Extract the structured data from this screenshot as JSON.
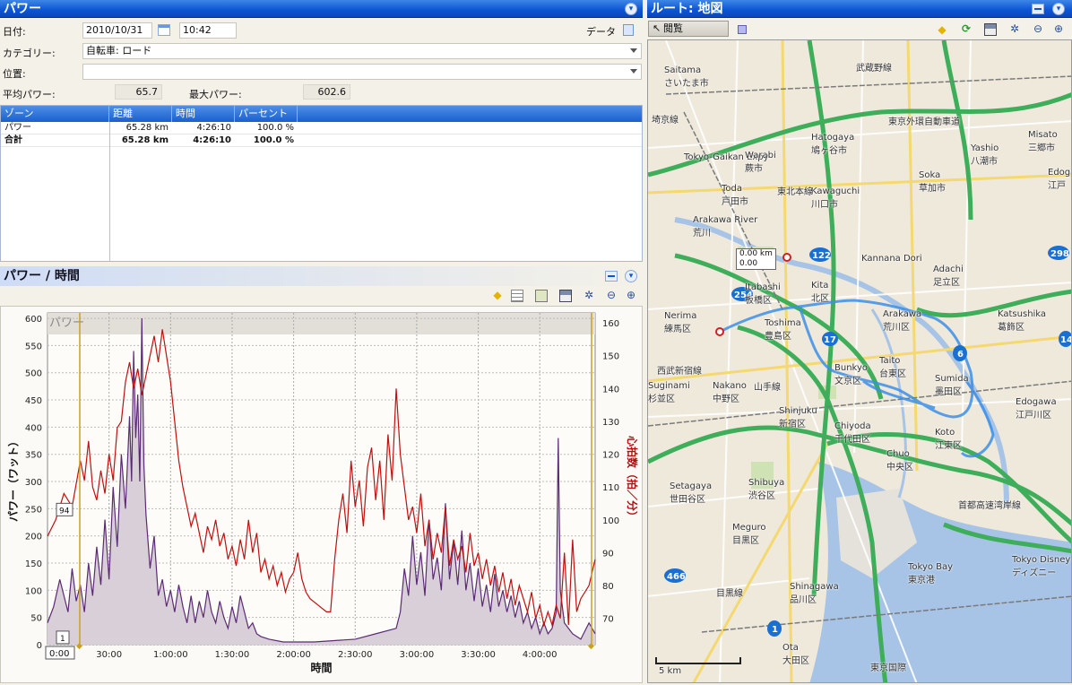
{
  "power_panel": {
    "title": "パワー",
    "date_label": "日付:",
    "date_value": "2010/10/31",
    "time_value": "10:42",
    "data_label": "データ",
    "category_label": "カテゴリー:",
    "category_value": "自転車: ロード",
    "location_label": "位置:",
    "location_value": "",
    "avg_power_label": "平均パワー:",
    "avg_power_value": "65.7",
    "max_power_label": "最大パワー:",
    "max_power_value": "602.6"
  },
  "zones_table": {
    "headers": [
      "ゾーン",
      "距離",
      "時間",
      "パーセント"
    ],
    "rows": [
      {
        "zone": "パワー",
        "distance": "65.28 km",
        "time": "4:26:10",
        "percent": "100.0 %"
      },
      {
        "zone": "合計",
        "distance": "65.28 km",
        "time": "4:26:10",
        "percent": "100.0 %"
      }
    ]
  },
  "chart_panel": {
    "title": "パワー / 時間",
    "overlay_label": "パワー",
    "cursor_value_label": "94",
    "cursor_marker_label": "1",
    "cursor_time_label": "0:00"
  },
  "chart_data": {
    "type": "line",
    "xlabel": "時間",
    "ylabel_left": "パワー（ワット）",
    "ylabel_right": "心拍数（拍／分）",
    "x_ticks": [
      "30:00",
      "1:00:00",
      "1:30:00",
      "2:00:00",
      "2:30:00",
      "3:00:00",
      "3:30:00",
      "4:00:00"
    ],
    "y_left_ticks": [
      0,
      50,
      100,
      150,
      200,
      250,
      300,
      350,
      400,
      450,
      500,
      550,
      600
    ],
    "y_right_ticks": [
      70,
      80,
      90,
      100,
      110,
      120,
      130,
      140,
      150,
      160
    ],
    "ylim_left": [
      0,
      610
    ],
    "ylim_right": [
      62,
      163
    ],
    "xlim_minutes": [
      0,
      267
    ],
    "series": [
      {
        "name": "パワー",
        "color": "#5b2a74",
        "fill": "#d9cfd8",
        "points": [
          [
            0,
            40
          ],
          [
            3,
            70
          ],
          [
            6,
            120
          ],
          [
            8,
            90
          ],
          [
            10,
            60
          ],
          [
            12,
            140
          ],
          [
            14,
            80
          ],
          [
            16,
            110
          ],
          [
            18,
            60
          ],
          [
            20,
            150
          ],
          [
            22,
            90
          ],
          [
            24,
            180
          ],
          [
            26,
            110
          ],
          [
            28,
            230
          ],
          [
            30,
            120
          ],
          [
            32,
            290
          ],
          [
            34,
            180
          ],
          [
            36,
            350
          ],
          [
            38,
            250
          ],
          [
            40,
            420
          ],
          [
            41,
            300
          ],
          [
            42,
            540
          ],
          [
            43,
            380
          ],
          [
            44,
            460
          ],
          [
            45,
            300
          ],
          [
            46,
            600
          ],
          [
            47,
            330
          ],
          [
            48,
            240
          ],
          [
            50,
            140
          ],
          [
            52,
            200
          ],
          [
            54,
            90
          ],
          [
            56,
            120
          ],
          [
            58,
            70
          ],
          [
            60,
            100
          ],
          [
            62,
            60
          ],
          [
            64,
            110
          ],
          [
            66,
            70
          ],
          [
            68,
            40
          ],
          [
            70,
            90
          ],
          [
            72,
            40
          ],
          [
            74,
            80
          ],
          [
            76,
            50
          ],
          [
            78,
            100
          ],
          [
            80,
            60
          ],
          [
            82,
            40
          ],
          [
            84,
            80
          ],
          [
            86,
            50
          ],
          [
            88,
            30
          ],
          [
            90,
            70
          ],
          [
            92,
            40
          ],
          [
            94,
            90
          ],
          [
            96,
            60
          ],
          [
            98,
            30
          ],
          [
            100,
            40
          ],
          [
            102,
            20
          ],
          [
            104,
            15
          ],
          [
            108,
            10
          ],
          [
            115,
            5
          ],
          [
            130,
            5
          ],
          [
            150,
            10
          ],
          [
            160,
            20
          ],
          [
            170,
            30
          ],
          [
            172,
            60
          ],
          [
            174,
            140
          ],
          [
            176,
            90
          ],
          [
            178,
            200
          ],
          [
            180,
            110
          ],
          [
            182,
            170
          ],
          [
            184,
            90
          ],
          [
            186,
            230
          ],
          [
            188,
            120
          ],
          [
            190,
            160
          ],
          [
            192,
            100
          ],
          [
            194,
            260
          ],
          [
            196,
            120
          ],
          [
            198,
            190
          ],
          [
            200,
            110
          ],
          [
            202,
            210
          ],
          [
            204,
            100
          ],
          [
            206,
            150
          ],
          [
            208,
            80
          ],
          [
            210,
            140
          ],
          [
            212,
            70
          ],
          [
            214,
            110
          ],
          [
            216,
            60
          ],
          [
            218,
            130
          ],
          [
            220,
            70
          ],
          [
            222,
            100
          ],
          [
            224,
            60
          ],
          [
            226,
            90
          ],
          [
            228,
            50
          ],
          [
            230,
            80
          ],
          [
            232,
            40
          ],
          [
            234,
            60
          ],
          [
            236,
            30
          ],
          [
            238,
            50
          ],
          [
            240,
            20
          ],
          [
            242,
            40
          ],
          [
            244,
            20
          ],
          [
            246,
            30
          ],
          [
            248,
            60
          ],
          [
            249,
            380
          ],
          [
            250,
            100
          ],
          [
            252,
            40
          ],
          [
            256,
            20
          ],
          [
            260,
            10
          ],
          [
            264,
            40
          ],
          [
            267,
            20
          ]
        ]
      },
      {
        "name": "心拍数",
        "color": "#c01010",
        "points": [
          [
            0,
            95
          ],
          [
            4,
            100
          ],
          [
            8,
            108
          ],
          [
            12,
            104
          ],
          [
            16,
            118
          ],
          [
            18,
            112
          ],
          [
            20,
            124
          ],
          [
            22,
            110
          ],
          [
            24,
            106
          ],
          [
            26,
            115
          ],
          [
            28,
            108
          ],
          [
            30,
            120
          ],
          [
            32,
            112
          ],
          [
            34,
            128
          ],
          [
            36,
            130
          ],
          [
            38,
            142
          ],
          [
            40,
            148
          ],
          [
            42,
            140
          ],
          [
            44,
            146
          ],
          [
            46,
            138
          ],
          [
            48,
            144
          ],
          [
            50,
            150
          ],
          [
            52,
            156
          ],
          [
            54,
            148
          ],
          [
            56,
            158
          ],
          [
            58,
            150
          ],
          [
            60,
            142
          ],
          [
            62,
            130
          ],
          [
            64,
            118
          ],
          [
            66,
            110
          ],
          [
            68,
            104
          ],
          [
            70,
            98
          ],
          [
            72,
            102
          ],
          [
            74,
            96
          ],
          [
            76,
            90
          ],
          [
            78,
            98
          ],
          [
            80,
            94
          ],
          [
            82,
            100
          ],
          [
            84,
            92
          ],
          [
            86,
            96
          ],
          [
            88,
            88
          ],
          [
            90,
            92
          ],
          [
            92,
            86
          ],
          [
            94,
            94
          ],
          [
            96,
            88
          ],
          [
            98,
            100
          ],
          [
            100,
            90
          ],
          [
            102,
            96
          ],
          [
            104,
            84
          ],
          [
            106,
            88
          ],
          [
            108,
            82
          ],
          [
            110,
            86
          ],
          [
            112,
            80
          ],
          [
            114,
            84
          ],
          [
            116,
            78
          ],
          [
            118,
            82
          ],
          [
            120,
            84
          ],
          [
            122,
            90
          ],
          [
            124,
            82
          ],
          [
            126,
            78
          ],
          [
            128,
            76
          ],
          [
            132,
            74
          ],
          [
            136,
            72
          ],
          [
            138,
            72
          ],
          [
            140,
            88
          ],
          [
            142,
            100
          ],
          [
            144,
            108
          ],
          [
            146,
            96
          ],
          [
            148,
            118
          ],
          [
            150,
            104
          ],
          [
            152,
            112
          ],
          [
            154,
            98
          ],
          [
            156,
            116
          ],
          [
            158,
            122
          ],
          [
            160,
            106
          ],
          [
            162,
            118
          ],
          [
            164,
            100
          ],
          [
            166,
            126
          ],
          [
            168,
            112
          ],
          [
            170,
            140
          ],
          [
            172,
            120
          ],
          [
            174,
            110
          ],
          [
            176,
            100
          ],
          [
            178,
            104
          ],
          [
            180,
            96
          ],
          [
            182,
            108
          ],
          [
            184,
            92
          ],
          [
            186,
            100
          ],
          [
            188,
            88
          ],
          [
            190,
            96
          ],
          [
            192,
            90
          ],
          [
            194,
            104
          ],
          [
            196,
            86
          ],
          [
            198,
            94
          ],
          [
            200,
            88
          ],
          [
            202,
            92
          ],
          [
            204,
            84
          ],
          [
            206,
            96
          ],
          [
            208,
            86
          ],
          [
            210,
            90
          ],
          [
            212,
            82
          ],
          [
            214,
            88
          ],
          [
            216,
            80
          ],
          [
            218,
            86
          ],
          [
            220,
            78
          ],
          [
            222,
            84
          ],
          [
            224,
            76
          ],
          [
            226,
            82
          ],
          [
            228,
            74
          ],
          [
            230,
            80
          ],
          [
            232,
            76
          ],
          [
            234,
            72
          ],
          [
            236,
            78
          ],
          [
            238,
            70
          ],
          [
            240,
            74
          ],
          [
            242,
            68
          ],
          [
            244,
            72
          ],
          [
            246,
            68
          ],
          [
            248,
            74
          ],
          [
            250,
            70
          ],
          [
            252,
            90
          ],
          [
            254,
            68
          ],
          [
            256,
            94
          ],
          [
            258,
            72
          ],
          [
            260,
            76
          ],
          [
            264,
            80
          ],
          [
            267,
            88
          ]
        ]
      }
    ]
  },
  "map_panel": {
    "title": "ルート: 地図",
    "view_label": "閲覧",
    "start_distance": "0.00 km",
    "start_time": "0.00",
    "scale_label": "5 km",
    "places": [
      {
        "text": "Saitama",
        "sub": "さいたま市"
      },
      {
        "text": "武蔵野線",
        "sub": ""
      },
      {
        "text": "東京外環自動車道",
        "sub": ""
      },
      {
        "text": "Tokyo-Gaikan Expy",
        "sub": ""
      },
      {
        "text": "Misato",
        "sub": "三郷市"
      },
      {
        "text": "Hatogaya",
        "sub": "鳩ヶ谷市"
      },
      {
        "text": "Warabi",
        "sub": "蕨市"
      },
      {
        "text": "Yashio",
        "sub": "八潮市"
      },
      {
        "text": "Edogawa",
        "sub": "江戸"
      },
      {
        "text": "Toda",
        "sub": "戸田市"
      },
      {
        "text": "Kawaguchi",
        "sub": "川口市"
      },
      {
        "text": "Soka",
        "sub": "草加市"
      },
      {
        "text": "Arakawa River",
        "sub": "荒川"
      },
      {
        "text": "Kannana Dori",
        "sub": ""
      },
      {
        "text": "Adachi",
        "sub": "足立区"
      },
      {
        "text": "Itabashi",
        "sub": "板橋区"
      },
      {
        "text": "Kita",
        "sub": "北区"
      },
      {
        "text": "Katsushika",
        "sub": "葛飾区"
      },
      {
        "text": "Nerima",
        "sub": "練馬区"
      },
      {
        "text": "Toshima",
        "sub": "豊島区"
      },
      {
        "text": "Arakawa",
        "sub": "荒川区"
      },
      {
        "text": "西武新宿線",
        "sub": ""
      },
      {
        "text": "Taito",
        "sub": "台東区"
      },
      {
        "text": "Sumida",
        "sub": "墨田区"
      },
      {
        "text": "Suginami",
        "sub": "杉並区"
      },
      {
        "text": "Nakano",
        "sub": "中野区"
      },
      {
        "text": "Bunkyo",
        "sub": "文京区"
      },
      {
        "text": "Edogawa",
        "sub": "江戸川区"
      },
      {
        "text": "Shinjuku",
        "sub": "新宿区"
      },
      {
        "text": "Chiyoda",
        "sub": "千代田区"
      },
      {
        "text": "Koto",
        "sub": "江東区"
      },
      {
        "text": "Chuo",
        "sub": "中央区"
      },
      {
        "text": "Setagaya",
        "sub": "世田谷区"
      },
      {
        "text": "Shibuya",
        "sub": "渋谷区"
      },
      {
        "text": "首都高速湾岸線",
        "sub": ""
      },
      {
        "text": "Meguro",
        "sub": "目黒区"
      },
      {
        "text": "Tokyo Bay",
        "sub": "東京港"
      },
      {
        "text": "Tokyo Disney",
        "sub": "ディズニー"
      },
      {
        "text": "Shinagawa",
        "sub": "品川区"
      },
      {
        "text": "Ota",
        "sub": "大田区"
      },
      {
        "text": "東京国際",
        "sub": ""
      },
      {
        "text": "目黒線",
        "sub": ""
      },
      {
        "text": "山手線",
        "sub": ""
      },
      {
        "text": "東北本線",
        "sub": ""
      },
      {
        "text": "埼京線",
        "sub": ""
      }
    ],
    "route_shields": [
      "122",
      "254",
      "17",
      "6",
      "298",
      "466",
      "1",
      "14"
    ]
  },
  "colors": {
    "titlebar": "#0b54d4",
    "power_line": "#5b2a74",
    "hr_line": "#c01010",
    "route": "#3b8ee8",
    "expressway": "#3fae5a"
  }
}
